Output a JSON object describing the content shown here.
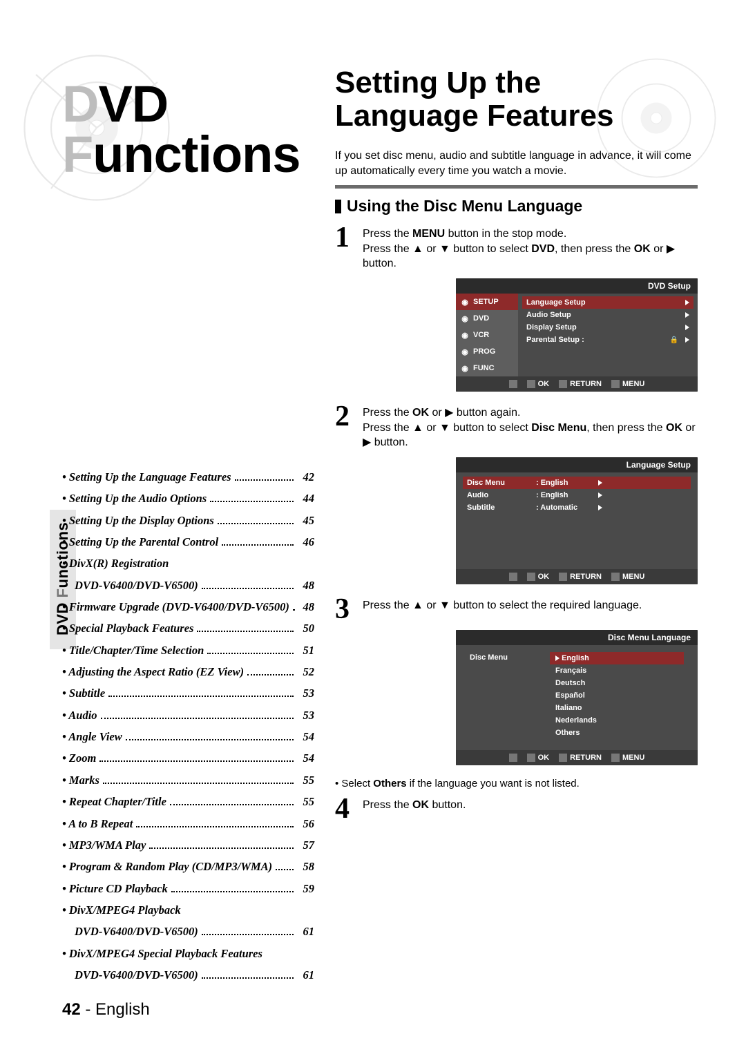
{
  "side_tab": {
    "prefix": "DVD ",
    "f": "F",
    "rest": "unctions"
  },
  "left_title": {
    "d": "D",
    "vd": "VD",
    "f": "F",
    "unctions": "unctions"
  },
  "toc": [
    {
      "label": "• Setting Up the Language Features",
      "page": "42"
    },
    {
      "label": "• Setting Up the Audio Options",
      "page": "44"
    },
    {
      "label": "• Setting Up the Display Options",
      "page": "45"
    },
    {
      "label": "• Setting Up the Parental Control",
      "page": "46"
    },
    {
      "label": "• DivX(R) Registration",
      "sub": "DVD-V6400/DVD-V6500)",
      "page": "48",
      "twoline": true
    },
    {
      "label": "• Firmware Upgrade (DVD-V6400/DVD-V6500)",
      "page": "48"
    },
    {
      "label": "• Special Playback Features",
      "page": "50"
    },
    {
      "label": "• Title/Chapter/Time Selection",
      "page": "51"
    },
    {
      "label": "• Adjusting the Aspect Ratio (EZ View)",
      "page": "52"
    },
    {
      "label": "• Subtitle",
      "page": "53"
    },
    {
      "label": "• Audio",
      "page": "53"
    },
    {
      "label": "• Angle View",
      "page": "54"
    },
    {
      "label": "• Zoom",
      "page": "54"
    },
    {
      "label": "• Marks",
      "page": "55"
    },
    {
      "label": "• Repeat Chapter/Title",
      "page": "55"
    },
    {
      "label": "• A to B Repeat",
      "page": "56"
    },
    {
      "label": "• MP3/WMA Play",
      "page": "57"
    },
    {
      "label": "• Program & Random Play (CD/MP3/WMA)",
      "page": "58"
    },
    {
      "label": "• Picture CD Playback",
      "page": "59"
    },
    {
      "label": "• DivX/MPEG4 Playback",
      "sub": "DVD-V6400/DVD-V6500)",
      "page": "61",
      "twoline": true
    },
    {
      "label": "• DivX/MPEG4 Special Playback Features",
      "sub": "DVD-V6400/DVD-V6500)",
      "page": "61",
      "twoline": true
    }
  ],
  "footer": {
    "page": "42",
    "sep": " - ",
    "lang": "English"
  },
  "right": {
    "title_l1": "Setting Up the",
    "title_l2": "Language Features",
    "intro": "If you set disc menu, audio and subtitle language in advance, it will come up automatically every time you watch a movie.",
    "h3": "Using the Disc Menu Language",
    "step1_a": "Press the ",
    "step1_menu": "MENU",
    "step1_b": " button in the stop mode.",
    "step1_c": "Press the ▲ or ▼ button to select ",
    "step1_dvd": "DVD",
    "step1_d": ", then press the ",
    "step1_ok": "OK",
    "step1_e": " or ▶ button.",
    "step2_a": "Press the ",
    "step2_ok": "OK",
    "step2_b": " or ▶ button again.",
    "step2_c": "Press the ▲ or ▼ button to select ",
    "step2_dm": "Disc Menu",
    "step2_d": ", then press the ",
    "step2_ok2": "OK",
    "step2_e": " or ▶ button.",
    "step3": "Press the ▲ or ▼ button to select the required language.",
    "note_a": "Select ",
    "note_b": "Others",
    "note_c": " if the language you want is not listed.",
    "step4_a": "Press the ",
    "step4_ok": "OK",
    "step4_b": " button."
  },
  "osd1": {
    "title": "DVD  Setup",
    "left": [
      {
        "name": "SETUP",
        "sel": true
      },
      {
        "name": "DVD"
      },
      {
        "name": "VCR"
      },
      {
        "name": "PROG"
      },
      {
        "name": "FUNC"
      }
    ],
    "rows": [
      {
        "l": "Language Setup",
        "sel": true
      },
      {
        "l": "Audio Setup"
      },
      {
        "l": "Display Setup"
      },
      {
        "l": "Parental Setup :",
        "lock": true
      }
    ],
    "fb": {
      "ok": "OK",
      "ret": "RETURN",
      "menu": "MENU"
    }
  },
  "osd2": {
    "title": "Language Setup",
    "rows": [
      {
        "l": "Disc Menu",
        "v": ": English",
        "sel": true
      },
      {
        "l": "Audio",
        "v": ": English"
      },
      {
        "l": "Subtitle",
        "v": ": Automatic"
      }
    ],
    "fb": {
      "ok": "OK",
      "ret": "RETURN",
      "menu": "MENU"
    }
  },
  "osd3": {
    "title": "Disc Menu Language",
    "left_label": "Disc Menu",
    "langs": [
      {
        "l": "English",
        "sel": true,
        "arrow": true
      },
      {
        "l": "Français"
      },
      {
        "l": "Deutsch"
      },
      {
        "l": "Español"
      },
      {
        "l": "Italiano"
      },
      {
        "l": "Nederlands"
      },
      {
        "l": "Others"
      }
    ],
    "fb": {
      "ok": "OK",
      "ret": "RETURN",
      "menu": "MENU"
    }
  }
}
